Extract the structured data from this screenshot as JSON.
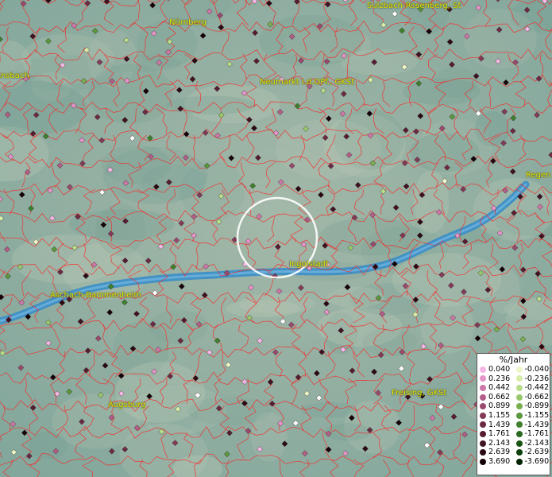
{
  "map": {
    "cities": [
      {
        "name": "Nürnberg"
      },
      {
        "name": "Sulzbach-Rosenberg, St"
      },
      {
        "name": "Ansbach"
      },
      {
        "name": "Neumarkt i.d.OPf., GKSt"
      },
      {
        "name": "Regen"
      },
      {
        "name": "Ingolstadt"
      },
      {
        "name": "Aschach-Bammenheim"
      },
      {
        "name": "Augsburg"
      },
      {
        "name": "Freising, GKSt"
      }
    ]
  },
  "legend": {
    "title": "%/Jahr",
    "positive": [
      {
        "value": "0.040",
        "color": "#f4b6e4"
      },
      {
        "value": "0.236",
        "color": "#e494c8"
      },
      {
        "value": "0.442",
        "color": "#cc78a8"
      },
      {
        "value": "0.662",
        "color": "#b25e88"
      },
      {
        "value": "0.899",
        "color": "#9a4a6e"
      },
      {
        "value": "1.155",
        "color": "#823a58"
      },
      {
        "value": "1.439",
        "color": "#6c2a44"
      },
      {
        "value": "1.761",
        "color": "#561c32"
      },
      {
        "value": "2.143",
        "color": "#401222"
      },
      {
        "value": "2.639",
        "color": "#2a0814"
      },
      {
        "value": "3.690",
        "color": "#140008"
      }
    ],
    "negative": [
      {
        "value": "-0.040",
        "color": "#eef6c8"
      },
      {
        "value": "-0.236",
        "color": "#d6eca8"
      },
      {
        "value": "-0.442",
        "color": "#b8dc8a"
      },
      {
        "value": "-0.662",
        "color": "#98c86c"
      },
      {
        "value": "-0.899",
        "color": "#78b050"
      },
      {
        "value": "-1.155",
        "color": "#5a983c"
      },
      {
        "value": "-1.439",
        "color": "#3e802c"
      },
      {
        "value": "-1.761",
        "color": "#286a1e"
      },
      {
        "value": "-2.143",
        "color": "#165412"
      },
      {
        "value": "-2.639",
        "color": "#0a3e0a"
      },
      {
        "value": "-3.690",
        "color": "#022402"
      }
    ]
  },
  "style": {
    "boundary_color": "#ff2020",
    "river_color": "#3a8ec8",
    "highlight_ring_color": "#ffffff"
  }
}
